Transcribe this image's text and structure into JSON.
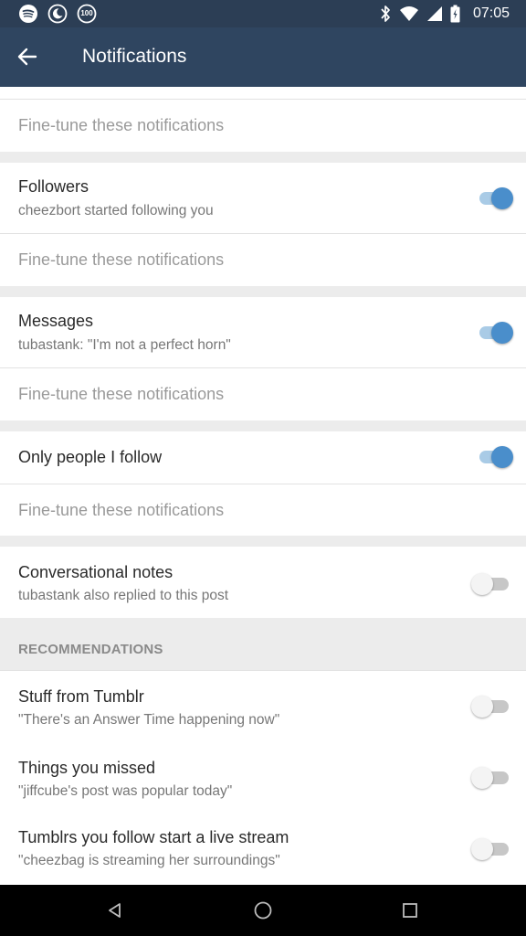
{
  "status_bar": {
    "time": "07:05",
    "battery_badge": "100",
    "left_icons": [
      "spotify-icon",
      "moon-icon",
      "badge-100-icon"
    ],
    "right_icons": [
      "bluetooth-icon",
      "wifi-icon",
      "signal-icon",
      "battery-icon"
    ]
  },
  "app_bar": {
    "title": "Notifications",
    "back_icon": "arrow-left-icon"
  },
  "colors": {
    "app_bar": "#2f4560",
    "status_bar": "#2c3e55",
    "toggle_on": "#4a8ecb",
    "toggle_on_track": "#a9cbe6",
    "toggle_off_knob": "#f4f4f4",
    "toggle_off_track": "#c7c7c7"
  },
  "fine_tune_label": "Fine-tune these notifications",
  "settings": [
    {
      "title": "Followers",
      "subtitle": "cheezbort started following you",
      "enabled": true
    },
    {
      "title": "Messages",
      "subtitle": "tubastank: \"I'm not a perfect horn\"",
      "enabled": true
    },
    {
      "title": "Only people I follow",
      "subtitle": "",
      "enabled": true
    },
    {
      "title": "Conversational notes",
      "subtitle": "tubastank also replied to this post",
      "enabled": false
    }
  ],
  "recommendations": {
    "header": "RECOMMENDATIONS",
    "items": [
      {
        "title": "Stuff from Tumblr",
        "subtitle": "\"There's an Answer Time happening now\"",
        "enabled": false
      },
      {
        "title": "Things you missed",
        "subtitle": "\"jiffcube's post was popular today\"",
        "enabled": false
      },
      {
        "title": "Tumblrs you follow start a live stream",
        "subtitle": "\"cheezbag is streaming her surroundings\"",
        "enabled": false
      }
    ]
  },
  "nav_bar": {
    "icons": [
      "back-triangle-icon",
      "home-circle-icon",
      "recents-square-icon"
    ]
  }
}
